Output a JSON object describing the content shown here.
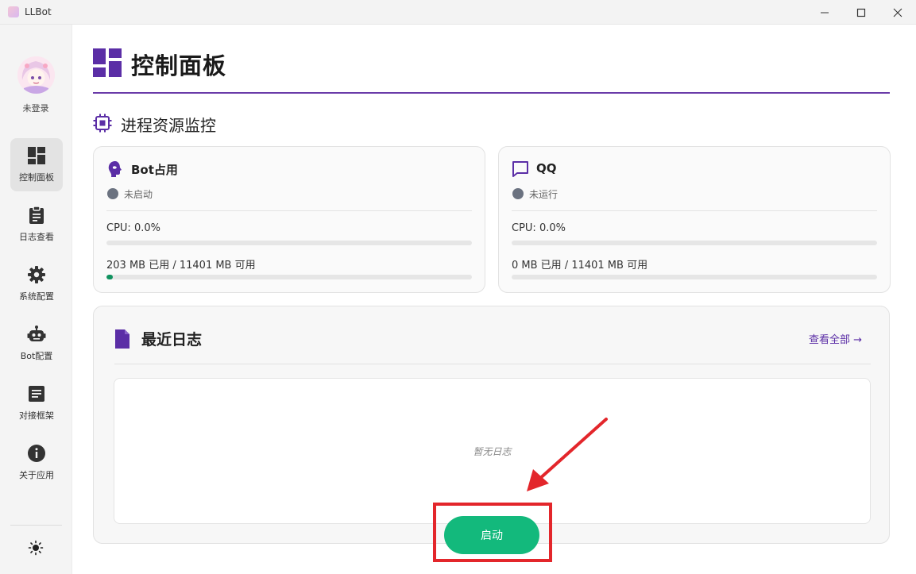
{
  "window": {
    "title": "LLBot",
    "minimize": "—",
    "maximize": "☐",
    "close": "✕"
  },
  "sidebar": {
    "user_label": "未登录",
    "items": [
      {
        "label": "控制面板",
        "icon": "dashboard-icon",
        "active": true
      },
      {
        "label": "日志查看",
        "icon": "clipboard-icon",
        "active": false
      },
      {
        "label": "系统配置",
        "icon": "gear-icon",
        "active": false
      },
      {
        "label": "Bot配置",
        "icon": "bot-icon",
        "active": false
      },
      {
        "label": "对接框架",
        "icon": "document-icon",
        "active": false
      },
      {
        "label": "关于应用",
        "icon": "info-icon",
        "active": false
      }
    ],
    "theme_icon": "sun-icon"
  },
  "page": {
    "title": "控制面板",
    "section_title": "进程资源监控"
  },
  "cards": {
    "bot": {
      "title": "Bot占用",
      "status": "未启动",
      "cpu": "CPU: 0.0%",
      "cpu_fraction": 0.0,
      "memory": "203 MB 已用 / 11401 MB 可用",
      "memory_fraction": 0.018
    },
    "qq": {
      "title": "QQ",
      "status": "未运行",
      "cpu": "CPU: 0.0%",
      "cpu_fraction": 0.0,
      "memory": "0 MB 已用 / 11401 MB 可用",
      "memory_fraction": 0.0
    }
  },
  "logs": {
    "title": "最近日志",
    "view_all": "查看全部 →",
    "empty": "暂无日志"
  },
  "actions": {
    "start": "启动"
  },
  "colors": {
    "accent": "#6a3ba8",
    "start_button": "#13b97c",
    "progress_fill": "#10925f",
    "highlight": "#e3262b",
    "status_idle": "#6b7280"
  }
}
